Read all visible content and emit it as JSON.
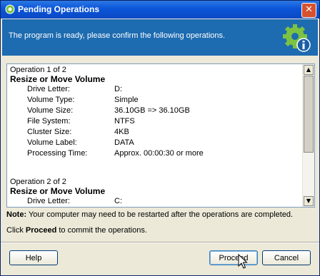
{
  "window": {
    "title": "Pending Operations",
    "close_glyph": "✕"
  },
  "header": {
    "message": "The program is ready, please confirm the following operations.",
    "icon": "gear-info-icon"
  },
  "operations": [
    {
      "counter": "Operation 1 of 2",
      "title": "Resize or Move Volume",
      "rows": [
        {
          "label": "Drive Letter:",
          "value": "D:"
        },
        {
          "label": "Volume Type:",
          "value": "Simple"
        },
        {
          "label": "Volume Size:",
          "value": "36.10GB => 36.10GB"
        },
        {
          "label": "File System:",
          "value": "NTFS"
        },
        {
          "label": "Cluster Size:",
          "value": "4KB"
        },
        {
          "label": "Volume Label:",
          "value": "DATA"
        },
        {
          "label": "Processing Time:",
          "value": "Approx. 00:00:30 or more"
        }
      ]
    },
    {
      "counter": "Operation 2 of 2",
      "title": "Resize or Move Volume",
      "rows": [
        {
          "label": "Drive Letter:",
          "value": "C:"
        }
      ]
    }
  ],
  "note": {
    "bold": "Note:",
    "text": " Your computer may need to be restarted after the operations are completed."
  },
  "instruction": {
    "pre": "Click ",
    "bold": "Proceed",
    "post": " to commit the operations."
  },
  "buttons": {
    "help": "Help",
    "proceed": "Proceed",
    "cancel": "Cancel"
  }
}
